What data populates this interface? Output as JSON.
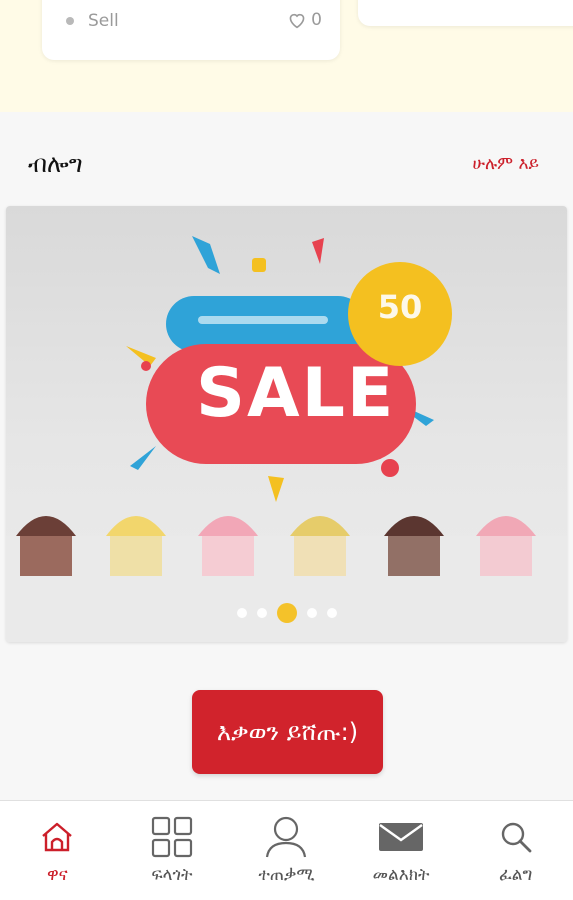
{
  "listing": {
    "sell_label": "Sell",
    "likes_count": "0"
  },
  "blog": {
    "title": "ብሎግ",
    "see_all": "ሁሉም እይ"
  },
  "banner": {
    "sale_text": "SALE",
    "slides": 5,
    "active_slide": 3
  },
  "cta": {
    "label": "እቃወን ይሸጡ:)"
  },
  "bottom_nav": {
    "items": [
      {
        "label": "ዋና",
        "icon": "home-icon",
        "active": true
      },
      {
        "label": "ፍላጎት",
        "icon": "grid-icon",
        "active": false
      },
      {
        "label": "ተጠቃሚ",
        "icon": "user-icon",
        "active": false
      },
      {
        "label": "መልእክት",
        "icon": "mail-icon",
        "active": false
      },
      {
        "label": "ፈልግ",
        "icon": "search-icon",
        "active": false
      }
    ]
  },
  "colors": {
    "accent": "#cc1f2a",
    "button": "#d1232c",
    "indicator": "#f4c020",
    "top_strip": "#fffbe7"
  }
}
